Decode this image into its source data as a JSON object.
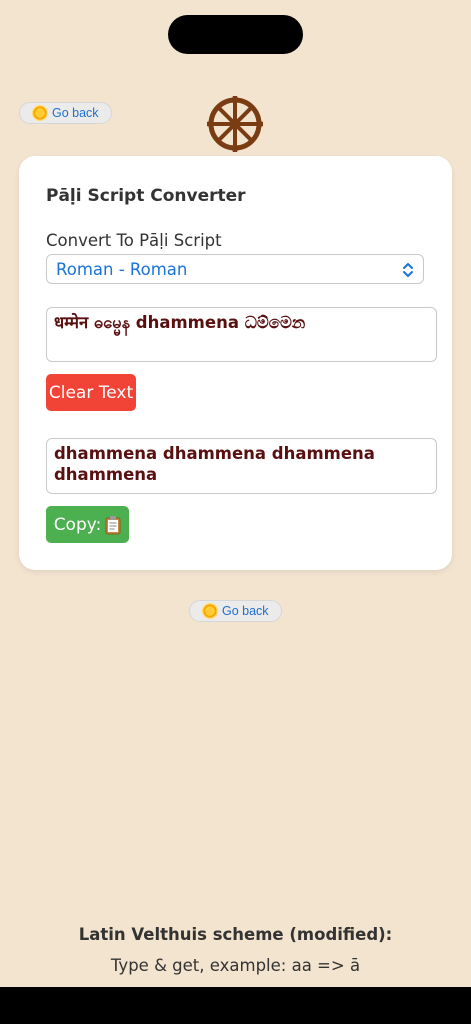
{
  "nav": {
    "go_back_top_label": "Go back",
    "go_back_bottom_label": "Go back"
  },
  "card": {
    "title": "Pāḷi Script Converter",
    "convert_label": "Convert To Pāḷi Script",
    "select_value": "Roman - Roman",
    "input_text": "धम्मेन ဓမ္မေန dhammena ධම්මෙන",
    "clear_label": "Clear Text",
    "output_text": "dhammena dhammena dhammena dhammena",
    "copy_label": "Copy:"
  },
  "footer": {
    "title": "Latin Velthuis scheme (modified):",
    "subtitle": "Type & get, example: aa => ā"
  },
  "colors": {
    "background": "#f2e4cf",
    "accent_link": "#1f6fd1",
    "clear_button": "#f14336",
    "copy_button": "#4cb050",
    "text_dark_red": "#5a1010",
    "wheel": "#7a3c12"
  },
  "icons": {
    "go_back": "sun-icon",
    "logo": "dharma-wheel-icon",
    "select": "chevron-up-down-icon",
    "copy": "clipboard-icon"
  }
}
